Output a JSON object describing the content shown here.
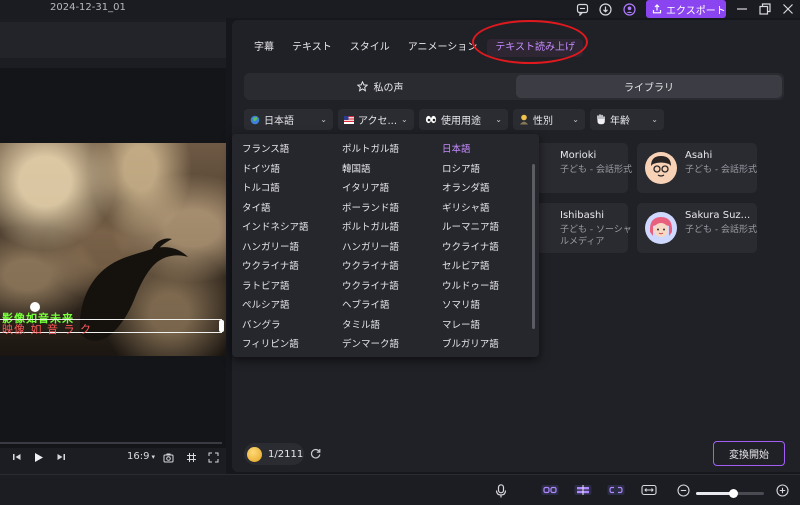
{
  "topbar": {
    "date": "2024-12-31_01",
    "export_label": "エクスポート"
  },
  "tabs": [
    "字幕",
    "テキスト",
    "スタイル",
    "アニメーション",
    "テキスト読み上げ"
  ],
  "active_tab": "テキスト読み上げ",
  "voice_toggle": {
    "my_voice": "私の声",
    "library": "ライブラリ"
  },
  "filters": {
    "language": "日本語",
    "accent": "アクセ...",
    "use": "使用用途",
    "gender": "性別",
    "age": "年齢"
  },
  "language_options": {
    "col1": [
      "フランス語",
      "ドイツ語",
      "トルコ語",
      "タイ語",
      "インドネシア語",
      "ハンガリー語",
      "ウクライナ語",
      "ラトビア語",
      "ペルシア語",
      "バングラ",
      "フィリピン語"
    ],
    "col2": [
      "ポルトガル語",
      "韓国語",
      "イタリア語",
      "ポーランド語",
      "ポルトガル語",
      "ハンガリー語",
      "ウクライナ語",
      "ウクライナ語",
      "ヘブライ語",
      "タミル語",
      "デンマーク語"
    ],
    "col3": [
      "日本語",
      "ロシア語",
      "オランダ語",
      "ギリシャ語",
      "ルーマニア語",
      "ウクライナ語",
      "セルビア語",
      "ウルドゥー語",
      "ソマリ語",
      "マレー語",
      "ブルガリア語"
    ]
  },
  "voices": [
    {
      "name": "Morioki",
      "desc": "子ども - 会話形式"
    },
    {
      "name": "Asahi",
      "desc": "子ども - 会話形式"
    },
    {
      "name": "Ishibashi",
      "desc": "子ども - ソーシャルメディア"
    },
    {
      "name": "Sakura Suz...",
      "desc": "子ども - 会話形式"
    }
  ],
  "preview": {
    "subtitle_line1": "影像如音未来",
    "subtitle_line2": "映像 如 音 ラ ク",
    "aspect_ratio": "16:9"
  },
  "footer": {
    "counter": "1/2111",
    "convert_label": "変換開始"
  },
  "zoom_level": 0.55,
  "colors": {
    "accent": "#8b45f0",
    "highlight_circle": "#e0191e",
    "selected_text": "#c58bff"
  }
}
